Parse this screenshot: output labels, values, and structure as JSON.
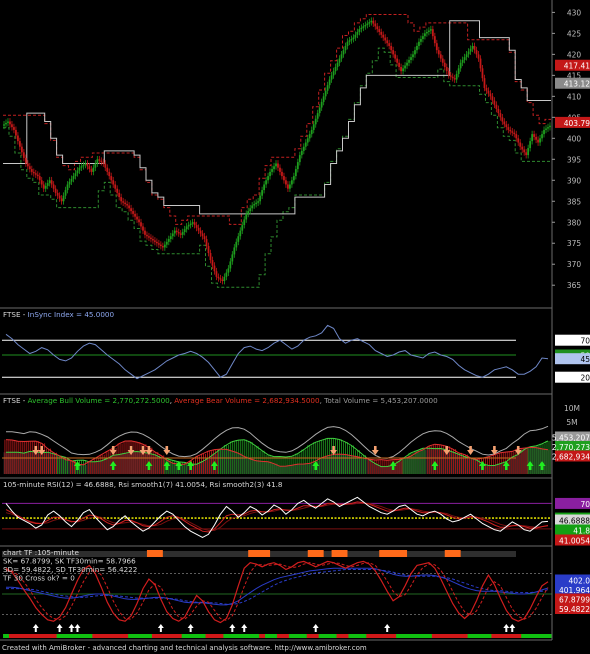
{
  "footer": "Created with AmiBroker - advanced charting and technical analysis software. http://www.amibroker.com",
  "colors": {
    "background": "#000000",
    "bull_candle": "#1e9e1e",
    "bear_candle": "#c41818",
    "stop_line": "#c8c8c8",
    "resistance": "#c42020",
    "support": "#2e8a2e",
    "insync": "#6f88c8",
    "rsi": "#ffffff",
    "rsi_smooth1": "#d02020",
    "rsi_smooth2": "#7a1010",
    "chart_tf_red": "#d01e1e",
    "chart_tf_blue": "#2a3cc8"
  },
  "chart_data": [
    {
      "type": "candlestick",
      "title": "",
      "ylim": [
        361,
        432
      ],
      "yticks": [
        "365",
        "370",
        "375",
        "380",
        "385",
        "390",
        "395",
        "400",
        "405",
        "410",
        "415",
        "420",
        "425",
        "430"
      ],
      "close": [
        404,
        402,
        398,
        394,
        392,
        391,
        388,
        390,
        387,
        385,
        389,
        391,
        393,
        394,
        392,
        395,
        394,
        391,
        388,
        385,
        384,
        382,
        380,
        377,
        376,
        375,
        374,
        376,
        378,
        377,
        379,
        380,
        378,
        376,
        371,
        367,
        366,
        369,
        374,
        378,
        382,
        384,
        385,
        389,
        392,
        394,
        391,
        388,
        391,
        396,
        399,
        402,
        406,
        410,
        414,
        417,
        420,
        423,
        424,
        426,
        427,
        428,
        426,
        424,
        422,
        419,
        416,
        418,
        420,
        423,
        425,
        426,
        421,
        418,
        415,
        414,
        418,
        420,
        422,
        419,
        412,
        410,
        407,
        404,
        402,
        401,
        398,
        396,
        401,
        399,
        402,
        403
      ],
      "price_tags": [
        {
          "label": "417.41",
          "value": 417.41,
          "color": "#c41818"
        },
        {
          "label": "413.12",
          "value": 413.12,
          "color": "#8a8a8a"
        },
        {
          "label": "403.79",
          "value": 403.79,
          "color": "#c41818"
        }
      ]
    },
    {
      "type": "line",
      "title": "FTSE - InSync Index = 45.0000",
      "title_parts": [
        {
          "text": "FTSE - ",
          "color": "#d8d8d8"
        },
        {
          "text": "InSync Index = 45.0000",
          "color": "#8ea8f0"
        }
      ],
      "ylim": [
        0,
        100
      ],
      "levels": [
        {
          "label": "70",
          "value": 70,
          "color": "#ffffff"
        },
        {
          "label": "50",
          "value": 50,
          "color": "#1f8f1f"
        },
        {
          "label": "20",
          "value": 20,
          "color": "#ffffff"
        }
      ],
      "value_tag": {
        "label": "45",
        "value": 45
      },
      "series": [
        {
          "values": [
            78,
            72,
            64,
            58,
            52,
            55,
            60,
            57,
            50,
            44,
            42,
            46,
            55,
            62,
            66,
            64,
            57,
            50,
            44,
            38,
            30,
            24,
            18,
            22,
            26,
            30,
            36,
            42,
            46,
            50,
            52,
            55,
            52,
            47,
            40,
            30,
            20,
            24,
            38,
            52,
            60,
            62,
            58,
            56,
            60,
            66,
            70,
            64,
            58,
            62,
            70,
            74,
            76,
            80,
            90,
            86,
            72,
            66,
            70,
            72,
            68,
            64,
            56,
            52,
            48,
            50,
            54,
            56,
            50,
            48,
            46,
            52,
            54,
            50,
            48,
            44,
            36,
            30,
            26,
            22,
            20,
            24,
            30,
            32,
            34,
            30,
            24,
            24,
            28,
            34,
            46,
            45
          ]
        }
      ]
    },
    {
      "type": "histogram",
      "title": "FTSE - Average Bull Volume = 2,770,272.5000, Average Bear Volume = 2,682,934.5000, Total Volume = 5,453,207.0000",
      "title_parts": [
        {
          "text": "FTSE - ",
          "color": "#d8d8d8"
        },
        {
          "text": "Average Bull Volume = 2,770,272.5000",
          "color": "#2ec12e"
        },
        {
          "text": ", ",
          "color": "#d8d8d8"
        },
        {
          "text": "Average Bear Volume = 2,682,934.5000",
          "color": "#e03020"
        },
        {
          "text": ", Total Volume = 5,453,207.0000",
          "color": "#9a9a9a"
        }
      ],
      "axis_labels": [
        "10M",
        "5M"
      ],
      "value_tags": [
        {
          "label": "5,453,207",
          "color": "#9a9a9a"
        },
        {
          "label": "2,770,273",
          "color": "#1f9f1f"
        },
        {
          "label": "2,682,934",
          "color": "#c41818"
        }
      ],
      "buy_arrows": [
        12,
        18,
        24,
        27,
        29,
        31,
        35,
        52,
        65,
        72,
        80,
        84,
        88,
        90
      ],
      "sell_arrows": [
        5,
        6,
        18,
        21,
        23,
        24,
        27,
        55,
        62,
        74,
        78,
        82,
        86
      ]
    },
    {
      "type": "line",
      "title": "105-minute RSI(12) = 46.6888, Rsi smooth1(7) 41.0054, Rsi smooth2(3) 41.8",
      "title_parts": [
        {
          "text": "105-minute RSI(12) = 46.6888, Rsi smooth1(7) 41.0054, Rsi smooth2(3) 41.8",
          "color": "#d8d8d8"
        }
      ],
      "ylim": [
        0,
        100
      ],
      "levels": [
        {
          "label": "70",
          "value": 70,
          "color": "#8a1fa0"
        },
        {
          "label": "51",
          "value": 51,
          "color": "#14a014"
        }
      ],
      "value_tags": [
        {
          "label": "46.6888",
          "color": "#d8d8d8"
        },
        {
          "label": "41.8",
          "color": "#14a014"
        },
        {
          "label": "41.0054",
          "color": "#c41818"
        }
      ],
      "series": [
        {
          "name": "RSI(12)",
          "values": [
            70,
            60,
            52,
            48,
            44,
            38,
            42,
            55,
            60,
            54,
            46,
            40,
            48,
            58,
            62,
            52,
            44,
            36,
            40,
            48,
            54,
            46,
            40,
            34,
            38,
            46,
            54,
            60,
            56,
            48,
            40,
            34,
            30,
            26,
            30,
            42,
            56,
            66,
            60,
            52,
            58,
            66,
            62,
            55,
            60,
            68,
            64,
            56,
            62,
            70,
            74,
            68,
            64,
            70,
            76,
            72,
            66,
            70,
            74,
            78,
            72,
            66,
            62,
            58,
            56,
            60,
            66,
            68,
            62,
            56,
            54,
            58,
            60,
            56,
            50,
            46,
            48,
            52,
            56,
            50,
            44,
            40,
            36,
            34,
            40,
            46,
            42,
            36,
            34,
            40,
            46,
            46.7
          ]
        },
        {
          "name": "Rsi smooth1(7)",
          "values": [
            62,
            58,
            54,
            50,
            46,
            44,
            44,
            48,
            52,
            52,
            49,
            46,
            47,
            51,
            55,
            54,
            50,
            45,
            42,
            44,
            48,
            48,
            45,
            41,
            40,
            42,
            47,
            52,
            54,
            52,
            47,
            42,
            38,
            34,
            33,
            37,
            45,
            54,
            56,
            55,
            56,
            60,
            61,
            59,
            59,
            62,
            63,
            61,
            61,
            64,
            67,
            67,
            66,
            67,
            70,
            70,
            69,
            69,
            70,
            72,
            71,
            69,
            66,
            63,
            60,
            60,
            62,
            64,
            63,
            60,
            58,
            58,
            59,
            58,
            55,
            52,
            50,
            51,
            53,
            52,
            49,
            46,
            42,
            39,
            39,
            41,
            42,
            40,
            38,
            38,
            40,
            41.0
          ]
        },
        {
          "name": "Rsi smooth2(3)",
          "values": [
            58,
            56,
            53,
            50,
            47,
            45,
            44,
            45,
            48,
            50,
            49,
            47,
            46,
            48,
            51,
            53,
            52,
            48,
            45,
            44,
            45,
            46,
            45,
            43,
            41,
            41,
            43,
            47,
            50,
            51,
            49,
            45,
            41,
            37,
            35,
            35,
            39,
            46,
            51,
            53,
            54,
            57,
            59,
            59,
            59,
            60,
            62,
            62,
            61,
            62,
            64,
            66,
            66,
            66,
            68,
            69,
            69,
            69,
            69,
            70,
            70,
            70,
            68,
            66,
            63,
            61,
            61,
            62,
            63,
            62,
            60,
            59,
            59,
            58,
            57,
            54,
            52,
            51,
            52,
            52,
            51,
            49,
            46,
            43,
            41,
            41,
            41,
            41,
            40,
            39,
            40,
            41.8
          ]
        }
      ]
    },
    {
      "type": "line",
      "title": "chart TF :105-minute",
      "text_lines": [
        "chart TF :105-minute",
        "SK= 67.8799,  SK TF30min= 58.7966",
        "SD= 59.4822,   SD TF30min= 56.4222",
        "TF 30 Cross ok? = 0"
      ],
      "ylim": [
        0,
        100
      ],
      "value_tags": [
        {
          "label": "402.0",
          "color": "#2a3cc8"
        },
        {
          "label": "401.964",
          "color": "#2a3cc8"
        },
        {
          "label": "67.8799",
          "color": "#c41818"
        },
        {
          "label": "59.4822",
          "color": "#c41818"
        }
      ],
      "series": [
        {
          "name": "SK",
          "values": [
            88,
            82,
            70,
            56,
            44,
            30,
            20,
            12,
            10,
            16,
            30,
            50,
            70,
            86,
            92,
            80,
            60,
            38,
            22,
            12,
            10,
            18,
            36,
            58,
            72,
            64,
            42,
            24,
            14,
            10,
            16,
            32,
            48,
            40,
            24,
            12,
            8,
            14,
            34,
            62,
            88,
            96,
            94,
            90,
            94,
            96,
            92,
            86,
            90,
            96,
            98,
            94,
            90,
            94,
            98,
            96,
            92,
            88,
            92,
            96,
            98,
            94,
            84,
            70,
            54,
            40,
            46,
            62,
            80,
            92,
            94,
            96,
            88,
            72,
            54,
            36,
            22,
            14,
            22,
            40,
            62,
            78,
            64,
            44,
            26,
            14,
            10,
            14,
            28,
            46,
            62,
            67.9
          ]
        },
        {
          "name": "SD",
          "values": [
            84,
            84,
            78,
            68,
            56,
            42,
            30,
            20,
            14,
            12,
            18,
            32,
            50,
            68,
            82,
            86,
            78,
            60,
            40,
            24,
            14,
            13,
            22,
            38,
            56,
            65,
            60,
            44,
            28,
            16,
            13,
            20,
            32,
            40,
            38,
            26,
            14,
            11,
            18,
            37,
            61,
            82,
            93,
            93,
            92,
            93,
            94,
            91,
            89,
            90,
            94,
            96,
            94,
            92,
            94,
            96,
            95,
            92,
            90,
            92,
            95,
            96,
            92,
            82,
            69,
            54,
            46,
            49,
            62,
            78,
            89,
            94,
            93,
            85,
            71,
            54,
            37,
            24,
            19,
            25,
            41,
            60,
            68,
            62,
            45,
            28,
            17,
            13,
            17,
            29,
            45,
            59.5
          ]
        },
        {
          "name": "SK TF30min",
          "values": [
            60,
            60,
            59,
            57,
            55,
            53,
            51,
            49,
            47,
            45,
            44,
            44,
            45,
            47,
            49,
            50,
            50,
            49,
            47,
            45,
            43,
            42,
            42,
            43,
            44,
            45,
            45,
            44,
            42,
            40,
            38,
            37,
            37,
            37,
            36,
            35,
            34,
            34,
            36,
            40,
            46,
            52,
            58,
            63,
            67,
            71,
            74,
            76,
            78,
            80,
            82,
            84,
            85,
            86,
            87,
            88,
            88,
            88,
            88,
            88,
            88,
            88,
            87,
            85,
            82,
            79,
            77,
            76,
            76,
            77,
            78,
            78,
            77,
            75,
            72,
            68,
            64,
            60,
            57,
            55,
            54,
            54,
            54,
            53,
            52,
            51,
            50,
            50,
            51,
            53,
            56,
            58.8
          ]
        },
        {
          "name": "SD TF30min",
          "values": [
            58,
            58,
            58,
            58,
            57,
            56,
            54,
            52,
            50,
            48,
            47,
            46,
            45,
            45,
            46,
            47,
            48,
            48,
            48,
            47,
            46,
            45,
            44,
            44,
            44,
            44,
            44,
            44,
            43,
            42,
            40,
            39,
            38,
            38,
            37,
            37,
            36,
            35,
            35,
            36,
            39,
            43,
            48,
            53,
            58,
            63,
            67,
            70,
            73,
            75,
            77,
            79,
            81,
            82,
            83,
            84,
            85,
            86,
            86,
            86,
            86,
            86,
            86,
            85,
            84,
            82,
            80,
            78,
            77,
            76,
            76,
            76,
            76,
            75,
            74,
            72,
            69,
            66,
            63,
            60,
            58,
            56,
            55,
            55,
            54,
            53,
            52,
            52,
            52,
            53,
            54,
            56.4
          ]
        }
      ]
    }
  ]
}
